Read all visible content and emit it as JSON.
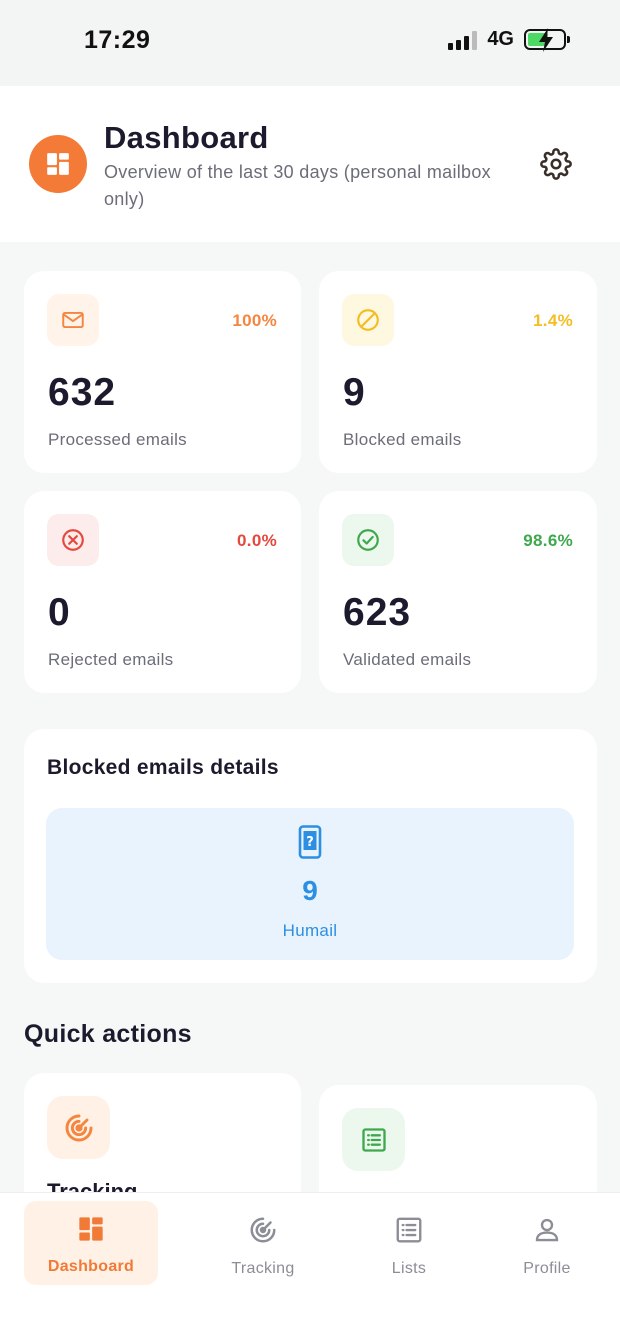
{
  "status_bar": {
    "time": "17:29",
    "network": "4G"
  },
  "header": {
    "title": "Dashboard",
    "subtitle": "Overview of the last 30 days (personal mailbox only)"
  },
  "stats": [
    {
      "percent": "100%",
      "value": "632",
      "label": "Processed emails",
      "icon": "mail-icon",
      "color": "#f4863f",
      "bg": "#fff3ea"
    },
    {
      "percent": "1.4%",
      "value": "9",
      "label": "Blocked emails",
      "icon": "block-icon",
      "color": "#f3be23",
      "bg": "#fff8e1"
    },
    {
      "percent": "0.0%",
      "value": "0",
      "label": "Rejected emails",
      "icon": "x-circle-icon",
      "color": "#e5483d",
      "bg": "#fdecec"
    },
    {
      "percent": "98.6%",
      "value": "623",
      "label": "Validated emails",
      "icon": "check-circle-icon",
      "color": "#3ea84c",
      "bg": "#ecf7ee"
    }
  ],
  "blocked_details": {
    "title": "Blocked emails details",
    "count": "9",
    "name": "Humail",
    "icon": "phone-question-icon",
    "color": "#2c8fe2"
  },
  "quick_actions": {
    "title": "Quick actions",
    "items": [
      {
        "label": "Tracking",
        "icon": "radar-icon"
      },
      {
        "label": "",
        "icon": "list-icon"
      }
    ]
  },
  "tabs": [
    {
      "label": "Dashboard",
      "icon": "dashboard-icon",
      "active": true
    },
    {
      "label": "Tracking",
      "icon": "radar-icon",
      "active": false
    },
    {
      "label": "Lists",
      "icon": "list-icon",
      "active": false
    },
    {
      "label": "Profile",
      "icon": "person-icon",
      "active": false
    }
  ],
  "colors": {
    "accent": "#f47a37",
    "blue": "#2c8fe2"
  }
}
